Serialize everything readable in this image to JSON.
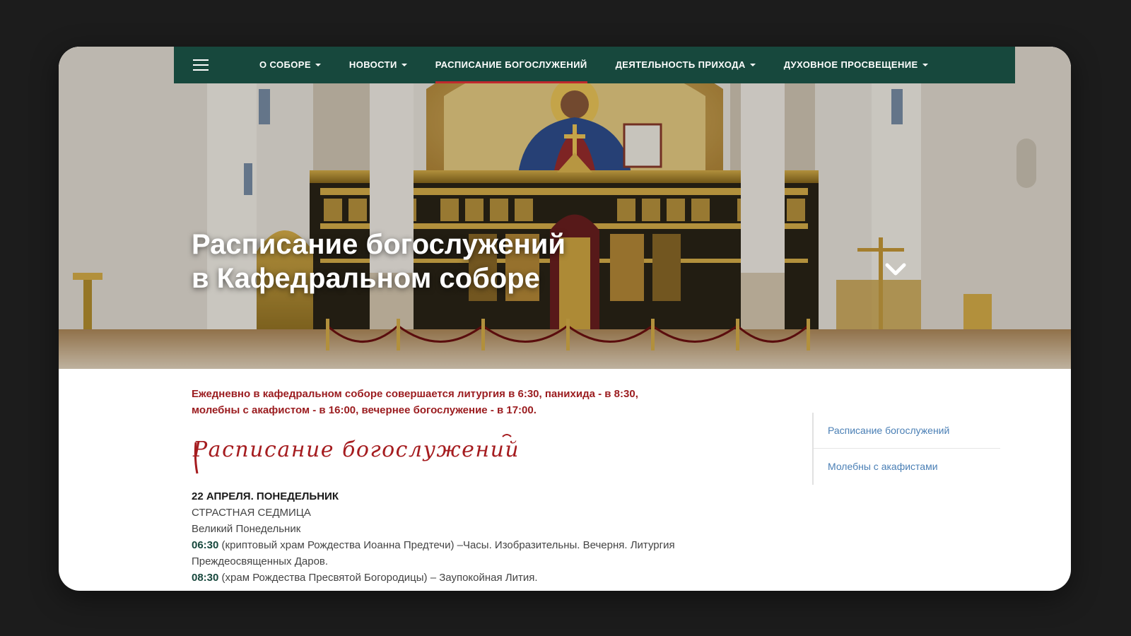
{
  "nav": {
    "items": [
      {
        "label": "О СОБОРЕ",
        "has_dropdown": true,
        "active": false
      },
      {
        "label": "НОВОСТИ",
        "has_dropdown": true,
        "active": false
      },
      {
        "label": "РАСПИСАНИЕ БОГОСЛУЖЕНИЙ",
        "has_dropdown": false,
        "active": true
      },
      {
        "label": "ДЕЯТЕЛЬНОСТЬ ПРИХОДА",
        "has_dropdown": true,
        "active": false
      },
      {
        "label": "ДУХОВНОЕ ПРОСВЕЩЕНИЕ",
        "has_dropdown": true,
        "active": false
      }
    ]
  },
  "hero": {
    "title_line1": "Расписание богослужений",
    "title_line2": "в Кафедральном соборе"
  },
  "notice": {
    "line1": "Ежедневно в кафедральном соборе совершается литургия в 6:30, панихида - в 8:30,",
    "line2": "молебны с акафистом - в 16:00, вечернее богослужение - в 17:00."
  },
  "schedule_heading": "Расписание богослужений",
  "schedule": {
    "date": "22 АПРЕЛЯ. ПОНЕДЕЛЬНИК",
    "week": "СТРАСТНАЯ СЕДМИЦА",
    "day": "Великий Понедельник",
    "entries": [
      {
        "time": "06:30",
        "text": " (криптовый храм Рождества Иоанна Предтечи) –Часы. Изобразительны. Вечерня. Литургия",
        "text_cont": "Преждеосвященных Даров."
      },
      {
        "time": "08:30",
        "text": " (храм Рождества Пресвятой Богородицы) – Заупокойная Лития."
      }
    ]
  },
  "sidebar": {
    "links": [
      "Расписание богослужений",
      "Молебны с акафистами"
    ]
  },
  "colors": {
    "nav_bg": "#17483d",
    "active_underline": "#c0282d",
    "notice_text": "#9b1d20",
    "link": "#4a7fb5",
    "time": "#17483d"
  }
}
